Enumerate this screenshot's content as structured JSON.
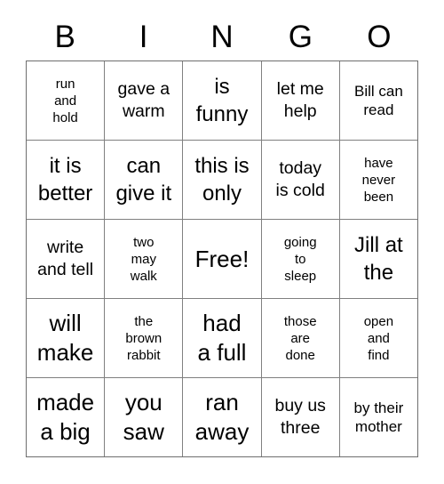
{
  "card": {
    "title": "BINGO",
    "header_letters": [
      "B",
      "I",
      "N",
      "G",
      "O"
    ],
    "columns": 5,
    "rows": 5,
    "free_space_label": "Free!",
    "free_space_position": {
      "row": 3,
      "column": 3
    },
    "colors": {
      "background": "#ffffff",
      "text": "#000000",
      "grid_line": "#808080"
    },
    "cells": [
      [
        {
          "text": "run\nand\nhold",
          "lines": [
            "run",
            "and",
            "hold"
          ],
          "size": "xs",
          "free": false
        },
        {
          "text": "gave a\nwarm",
          "lines": [
            "gave a",
            "warm"
          ],
          "size": "m",
          "free": false
        },
        {
          "text": "is\nfunny",
          "lines": [
            "is",
            "funny"
          ],
          "size": "l",
          "free": false
        },
        {
          "text": "let me\nhelp",
          "lines": [
            "let me",
            "help"
          ],
          "size": "m",
          "free": false
        },
        {
          "text": "Bill can\nread",
          "lines": [
            "Bill can",
            "read"
          ],
          "size": "s",
          "free": false
        }
      ],
      [
        {
          "text": "it is\nbetter",
          "lines": [
            "it is",
            "better"
          ],
          "size": "l",
          "free": false
        },
        {
          "text": "can\ngive it",
          "lines": [
            "can",
            "give it"
          ],
          "size": "l",
          "free": false
        },
        {
          "text": "this is\nonly",
          "lines": [
            "this is",
            "only"
          ],
          "size": "l",
          "free": false
        },
        {
          "text": "today\nis cold",
          "lines": [
            "today",
            "is cold"
          ],
          "size": "m",
          "free": false
        },
        {
          "text": "have\nnever\nbeen",
          "lines": [
            "have",
            "never",
            "been"
          ],
          "size": "xs",
          "free": false
        }
      ],
      [
        {
          "text": "write\nand tell",
          "lines": [
            "write",
            "and tell"
          ],
          "size": "m",
          "free": false
        },
        {
          "text": "two\nmay\nwalk",
          "lines": [
            "two",
            "may",
            "walk"
          ],
          "size": "xs",
          "free": false
        },
        {
          "text": "Free!",
          "lines": [
            "Free!"
          ],
          "size": "free",
          "free": true
        },
        {
          "text": "going\nto\nsleep",
          "lines": [
            "going",
            "to",
            "sleep"
          ],
          "size": "xs",
          "free": false
        },
        {
          "text": "Jill at\nthe",
          "lines": [
            "Jill at",
            "the"
          ],
          "size": "l",
          "free": false
        }
      ],
      [
        {
          "text": "will\nmake",
          "lines": [
            "will",
            "make"
          ],
          "size": "xl",
          "free": false
        },
        {
          "text": "the\nbrown\nrabbit",
          "lines": [
            "the",
            "brown",
            "rabbit"
          ],
          "size": "xs",
          "free": false
        },
        {
          "text": "had\na full",
          "lines": [
            "had",
            "a full"
          ],
          "size": "xl",
          "free": false
        },
        {
          "text": "those\nare\ndone",
          "lines": [
            "those",
            "are",
            "done"
          ],
          "size": "xs",
          "free": false
        },
        {
          "text": "open\nand\nfind",
          "lines": [
            "open",
            "and",
            "find"
          ],
          "size": "xs",
          "free": false
        }
      ],
      [
        {
          "text": "made\na big",
          "lines": [
            "made",
            "a big"
          ],
          "size": "xl",
          "free": false
        },
        {
          "text": "you\nsaw",
          "lines": [
            "you",
            "saw"
          ],
          "size": "xl",
          "free": false
        },
        {
          "text": "ran\naway",
          "lines": [
            "ran",
            "away"
          ],
          "size": "xl",
          "free": false
        },
        {
          "text": "buy us\nthree",
          "lines": [
            "buy us",
            "three"
          ],
          "size": "m",
          "free": false
        },
        {
          "text": "by their\nmother",
          "lines": [
            "by their",
            "mother"
          ],
          "size": "s",
          "free": false
        }
      ]
    ]
  }
}
